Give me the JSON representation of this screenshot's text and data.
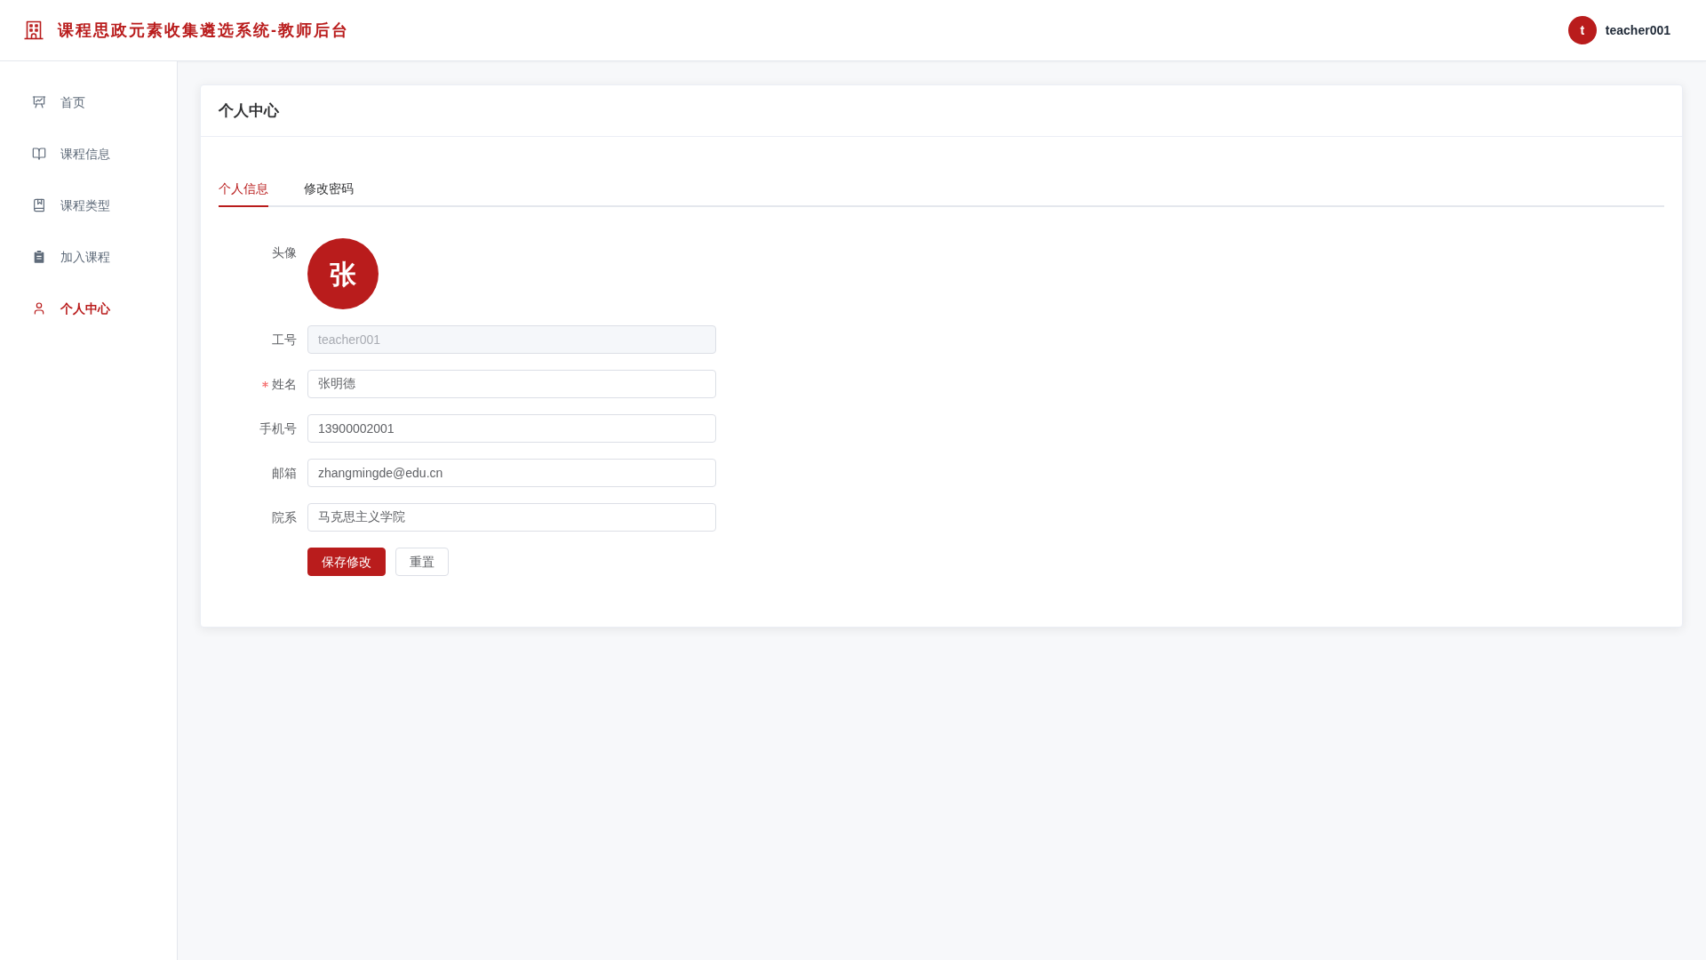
{
  "header": {
    "title": "课程思政元素收集遴选系统-教师后台",
    "user": {
      "avatar_letter": "t",
      "name": "teacher001"
    }
  },
  "sidebar": {
    "items": [
      {
        "label": "首页",
        "selected": false
      },
      {
        "label": "课程信息",
        "selected": false
      },
      {
        "label": "课程类型",
        "selected": false
      },
      {
        "label": "加入课程",
        "selected": false
      },
      {
        "label": "个人中心",
        "selected": true
      }
    ]
  },
  "page": {
    "title": "个人中心",
    "tabs": [
      {
        "label": "个人信息",
        "selected": true
      },
      {
        "label": "修改密码",
        "selected": false
      }
    ],
    "form": {
      "avatar": {
        "label": "头像",
        "letter": "张"
      },
      "fields": [
        {
          "label": "工号",
          "value": "teacher001",
          "required": false,
          "disabled": true
        },
        {
          "label": "姓名",
          "value": "张明德",
          "required": true,
          "disabled": false
        },
        {
          "label": "手机号",
          "value": "13900002001",
          "required": false,
          "disabled": false
        },
        {
          "label": "邮箱",
          "value": "zhangmingde@edu.cn",
          "required": false,
          "disabled": false
        },
        {
          "label": "院系",
          "value": "马克思主义学院",
          "required": false,
          "disabled": false
        }
      ],
      "buttons": [
        {
          "label": "保存修改",
          "kind": "primary"
        },
        {
          "label": "重置",
          "kind": "default"
        }
      ]
    }
  }
}
